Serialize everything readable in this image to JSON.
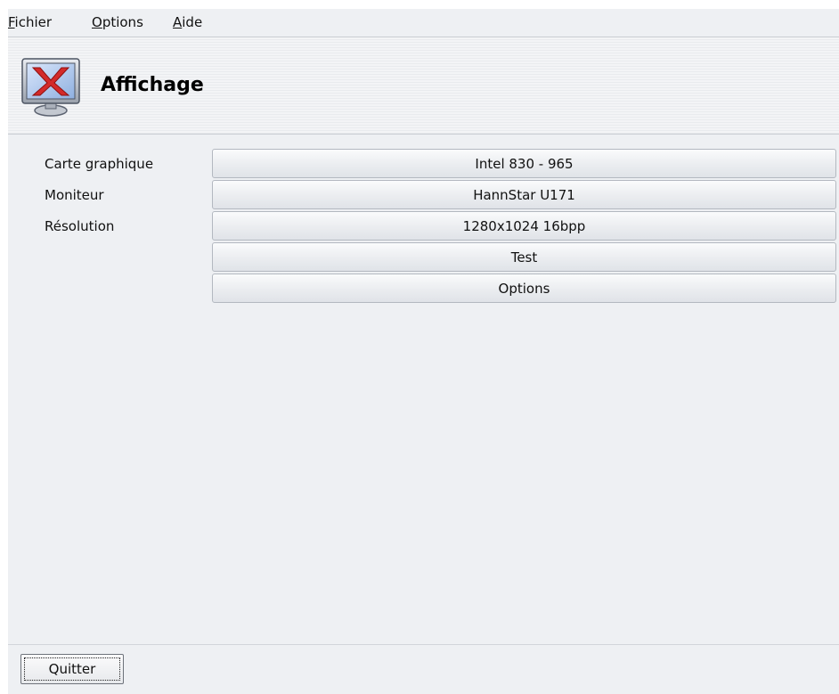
{
  "menubar": {
    "items": [
      {
        "mnemonic": "F",
        "rest": "ichier"
      },
      {
        "mnemonic": "O",
        "rest": "ptions"
      },
      {
        "mnemonic": "A",
        "rest": "ide"
      }
    ]
  },
  "header": {
    "title": "Affichage",
    "icon": "monitor-x-icon"
  },
  "rows": [
    {
      "label": "Carte graphique",
      "value": "Intel 830 - 965"
    },
    {
      "label": "Moniteur",
      "value": "HannStar U171"
    },
    {
      "label": "Résolution",
      "value": "1280x1024 16bpp"
    }
  ],
  "actions": {
    "test": "Test",
    "options": "Options"
  },
  "footer": {
    "quit": "Quitter"
  },
  "colors": {
    "icon_x": "#d32a2a",
    "icon_screen": "#a8c2e8"
  }
}
